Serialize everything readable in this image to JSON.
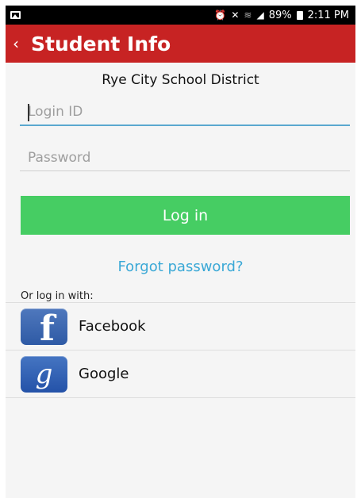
{
  "status_bar": {
    "battery": "89%",
    "time": "2:11 PM",
    "icons": [
      "image-icon",
      "alarm-icon",
      "mute-icon",
      "wifi-icon",
      "signal-icon",
      "battery-icon"
    ]
  },
  "header": {
    "back_icon": "‹",
    "title": "Student Info"
  },
  "district": "Rye City School District",
  "form": {
    "login_placeholder": "Login ID",
    "login_value": "",
    "password_placeholder": "Password",
    "password_value": "",
    "login_button": "Log in"
  },
  "forgot_link": "Forgot password?",
  "alt_login": {
    "label": "Or log in with:",
    "providers": [
      {
        "name": "Facebook",
        "icon_glyph": "f",
        "icon": "facebook-icon"
      },
      {
        "name": "Google",
        "icon_glyph": "g",
        "icon": "google-icon"
      }
    ]
  },
  "colors": {
    "header": "#c72323",
    "login_button": "#46cd63",
    "link": "#3aa8d6",
    "focus_underline": "#5aa8cf"
  }
}
